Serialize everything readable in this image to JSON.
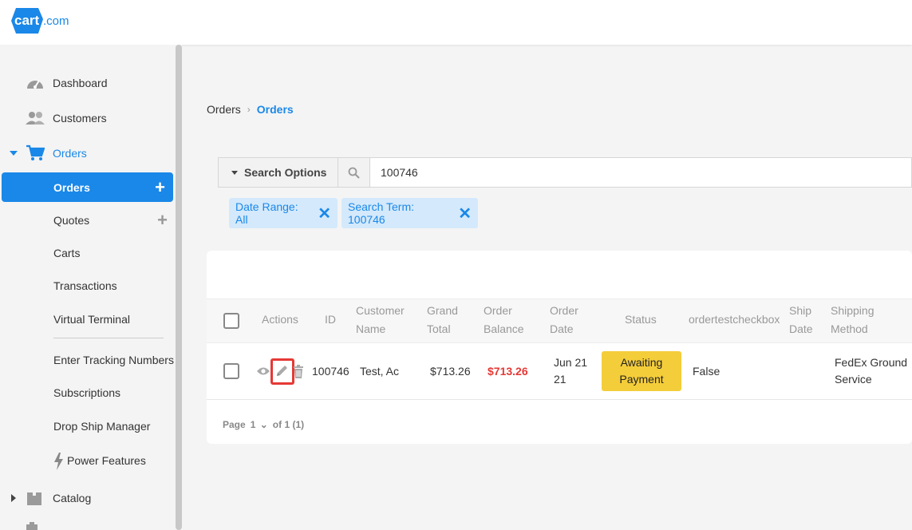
{
  "header": {
    "logo_text": "cart.com"
  },
  "sidebar": {
    "items": [
      {
        "label": "Dashboard"
      },
      {
        "label": "Customers"
      },
      {
        "label": "Orders"
      },
      {
        "label": "Catalog"
      }
    ],
    "orders_sub": [
      {
        "label": "Orders"
      },
      {
        "label": "Quotes"
      },
      {
        "label": "Carts"
      },
      {
        "label": "Transactions"
      },
      {
        "label": "Virtual Terminal"
      },
      {
        "label": "Enter Tracking Numbers"
      },
      {
        "label": "Subscriptions"
      },
      {
        "label": "Drop Ship Manager"
      },
      {
        "label": "Power Features"
      }
    ],
    "plus_symbol": "+"
  },
  "breadcrumb": {
    "parent": "Orders",
    "separator": "›",
    "current": "Orders"
  },
  "search": {
    "options_label": "Search Options",
    "value": "100746"
  },
  "filters": [
    {
      "label": "Date Range: All",
      "remove": "✕"
    },
    {
      "label": "Search Term: 100746",
      "remove": "✕"
    }
  ],
  "table": {
    "headers": {
      "actions": "Actions",
      "id": "ID",
      "customer_1": "Customer",
      "customer_2": "Name",
      "grand_1": "Grand",
      "grand_2": "Total",
      "balance_1": "Order",
      "balance_2": "Balance",
      "date_1": "Order",
      "date_2": "Date",
      "status": "Status",
      "custom": "ordertestcheckbox",
      "ship_1": "Ship",
      "ship_2": "Date",
      "method_1": "Shipping",
      "method_2": "Method"
    },
    "rows": [
      {
        "id": "100746",
        "customer": "Test, Ac",
        "grand_total": "$713.26",
        "balance": "$713.26",
        "date_1": "Jun 21",
        "date_2": "21",
        "status": "Awaiting Payment",
        "custom": "False",
        "ship_date": "",
        "method_1": "FedEx Ground",
        "method_2": "Service"
      }
    ]
  },
  "pager": {
    "page_label": "Page",
    "page": "1",
    "chevron": "⌄",
    "of_label": "of 1 (1)"
  },
  "colors": {
    "accent": "#1a88e8",
    "status_yellow": "#f4cd3a",
    "balance_red": "#e53935"
  }
}
